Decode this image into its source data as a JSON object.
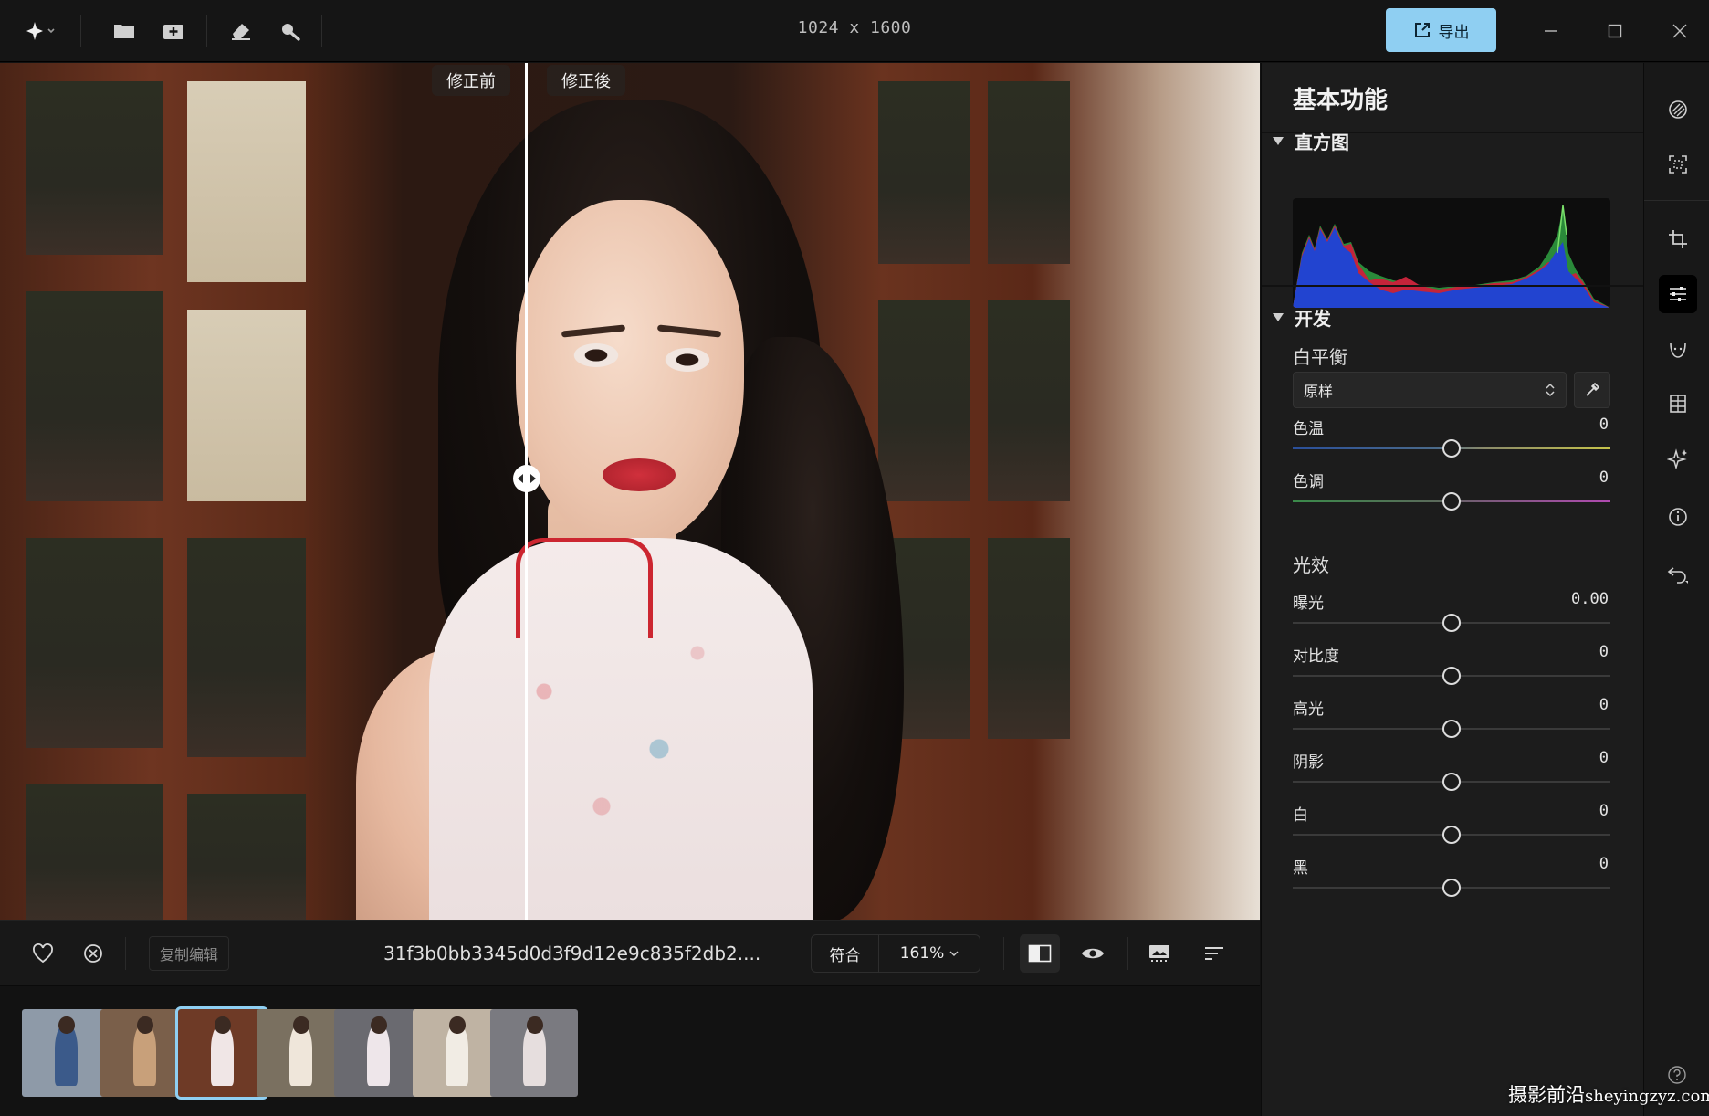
{
  "titlebar": {
    "image_dims": "1024 x 1600",
    "export_label": "导出"
  },
  "canvas": {
    "before_label": "修正前",
    "after_label": "修正後"
  },
  "bottombar": {
    "copy_edit_label": "复制编辑",
    "filename": "31f3b0bb3345d0d3f9d12e9c835f2db2....",
    "zoom_fit_label": "符合",
    "zoom_value": "161%"
  },
  "filmstrip": {
    "thumbnails": [
      {
        "bg": "#8e9aa8",
        "fig": "#3b5a8a"
      },
      {
        "bg": "#7a5f4a",
        "fig": "#c8a07a"
      },
      {
        "bg": "#6e3a26",
        "fig": "#f0e6e6",
        "selected": true
      },
      {
        "bg": "#7a7060",
        "fig": "#efe6da"
      },
      {
        "bg": "#6a6a70",
        "fig": "#eee6ea"
      },
      {
        "bg": "#bfb3a3",
        "fig": "#f1ece4"
      },
      {
        "bg": "#7a7a80",
        "fig": "#e6dede"
      }
    ]
  },
  "panel": {
    "title": "基本功能",
    "histogram": {
      "heading": "直方图"
    },
    "develop": {
      "heading": "开发",
      "white_balance": {
        "title": "白平衡",
        "preset": "原样",
        "sliders": [
          {
            "label": "色温",
            "value": "0",
            "level": 0.5
          },
          {
            "label": "色调",
            "value": "0",
            "level": 0.5
          }
        ]
      },
      "light": {
        "title": "光效",
        "sliders": [
          {
            "label": "曝光",
            "value": "0.00",
            "level": 0.5
          },
          {
            "label": "对比度",
            "value": "0",
            "level": 0.5
          },
          {
            "label": "高光",
            "value": "0",
            "level": 0.5
          },
          {
            "label": "阴影",
            "value": "0",
            "level": 0.5
          },
          {
            "label": "白",
            "value": "0",
            "level": 0.5
          },
          {
            "label": "黑",
            "value": "0",
            "level": 0.5
          }
        ]
      }
    }
  },
  "watermark": {
    "cn": "摄影前沿",
    "url": "sheyingzyz.com"
  },
  "colors": {
    "accent": "#8fcff2",
    "background": "#121212",
    "panel": "#1c1c1c"
  }
}
